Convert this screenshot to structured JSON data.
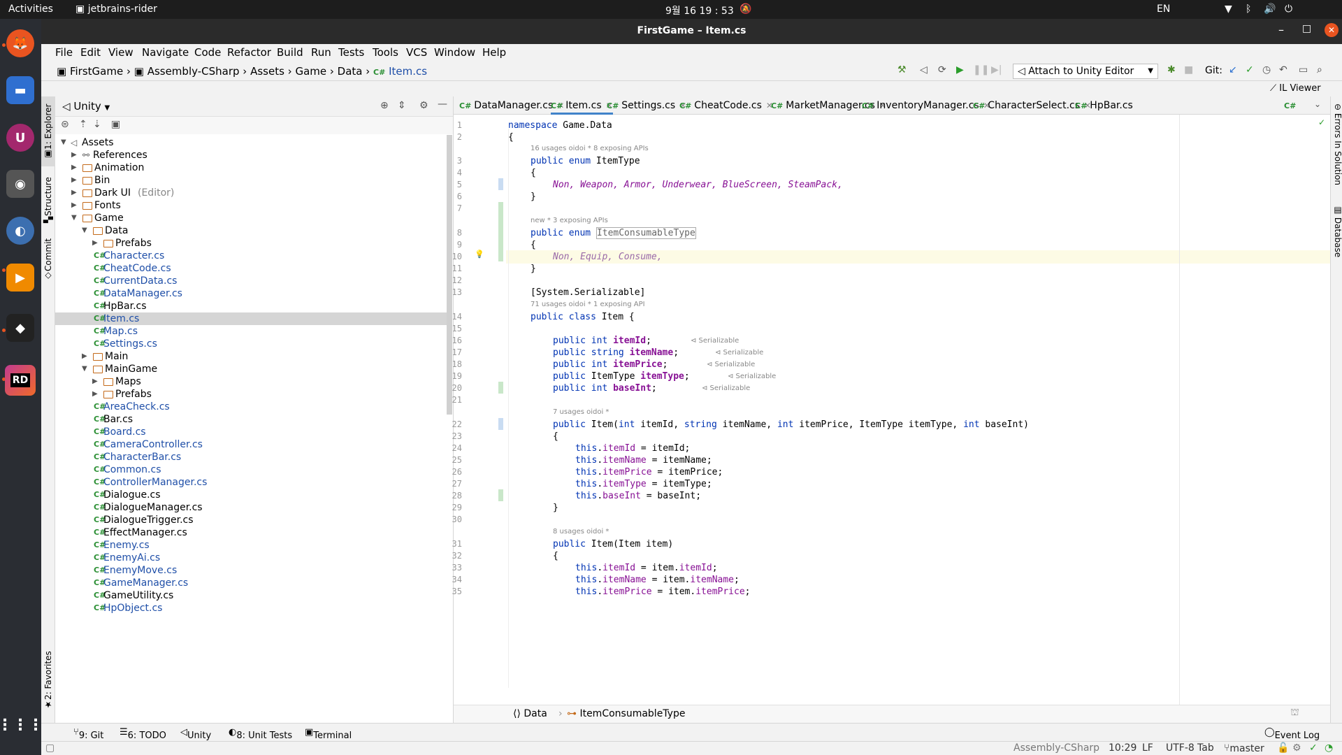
{
  "topbar": {
    "activities": "Activities",
    "app": "jetbrains-rider",
    "clock": "9월 16  19 : 53",
    "lang": "EN"
  },
  "window": {
    "title": "FirstGame – Item.cs"
  },
  "menu": [
    "File",
    "Edit",
    "View",
    "Navigate",
    "Code",
    "Refactor",
    "Build",
    "Run",
    "Tests",
    "Tools",
    "VCS",
    "Window",
    "Help"
  ],
  "nav": {
    "crumbs": [
      "FirstGame",
      "Assembly-CSharp",
      "Assets",
      "Game",
      "Data",
      "Item.cs"
    ],
    "run_config": "Attach to Unity Editor",
    "git": "Git:"
  },
  "il_viewer": "IL Viewer",
  "left_tabs": {
    "explorer": "1: Explorer",
    "structure": "Structure",
    "commit": "Commit",
    "favorites": "2: Favorites"
  },
  "right_tabs": {
    "errors": "Errors In Solution",
    "database": "Database"
  },
  "explorer": {
    "view": "Unity",
    "tree": [
      {
        "label": "Assets",
        "depth": 0,
        "kind": "root",
        "open": true
      },
      {
        "label": "References",
        "depth": 1,
        "kind": "ref",
        "open": false
      },
      {
        "label": "Animation",
        "depth": 1,
        "kind": "folder",
        "open": false
      },
      {
        "label": "Bin",
        "depth": 1,
        "kind": "folder",
        "open": false
      },
      {
        "label": "Dark UI",
        "extra": "(Editor)",
        "depth": 1,
        "kind": "folder",
        "open": false
      },
      {
        "label": "Fonts",
        "depth": 1,
        "kind": "folder",
        "open": false
      },
      {
        "label": "Game",
        "depth": 1,
        "kind": "folder",
        "open": true
      },
      {
        "label": "Data",
        "depth": 2,
        "kind": "folder",
        "open": true
      },
      {
        "label": "Prefabs",
        "depth": 3,
        "kind": "folder",
        "open": false
      },
      {
        "label": "Character.cs",
        "depth": 3,
        "kind": "cs",
        "mod": true
      },
      {
        "label": "CheatCode.cs",
        "depth": 3,
        "kind": "cs",
        "mod": true
      },
      {
        "label": "CurrentData.cs",
        "depth": 3,
        "kind": "cs",
        "mod": true
      },
      {
        "label": "DataManager.cs",
        "depth": 3,
        "kind": "cs",
        "mod": true
      },
      {
        "label": "HpBar.cs",
        "depth": 3,
        "kind": "cs",
        "mod": false
      },
      {
        "label": "Item.cs",
        "depth": 3,
        "kind": "cs",
        "mod": true,
        "selected": true
      },
      {
        "label": "Map.cs",
        "depth": 3,
        "kind": "cs",
        "mod": true
      },
      {
        "label": "Settings.cs",
        "depth": 3,
        "kind": "cs",
        "mod": true
      },
      {
        "label": "Main",
        "depth": 2,
        "kind": "folder",
        "open": false
      },
      {
        "label": "MainGame",
        "depth": 2,
        "kind": "folder",
        "open": true
      },
      {
        "label": "Maps",
        "depth": 3,
        "kind": "folder",
        "open": false
      },
      {
        "label": "Prefabs",
        "depth": 3,
        "kind": "folder",
        "open": false
      },
      {
        "label": "AreaCheck.cs",
        "depth": 3,
        "kind": "cs",
        "mod": true
      },
      {
        "label": "Bar.cs",
        "depth": 3,
        "kind": "cs",
        "mod": false
      },
      {
        "label": "Board.cs",
        "depth": 3,
        "kind": "cs",
        "mod": true
      },
      {
        "label": "CameraController.cs",
        "depth": 3,
        "kind": "cs",
        "mod": true
      },
      {
        "label": "CharacterBar.cs",
        "depth": 3,
        "kind": "cs",
        "mod": true
      },
      {
        "label": "Common.cs",
        "depth": 3,
        "kind": "cs",
        "mod": true
      },
      {
        "label": "ControllerManager.cs",
        "depth": 3,
        "kind": "cs",
        "mod": true
      },
      {
        "label": "Dialogue.cs",
        "depth": 3,
        "kind": "cs",
        "mod": false
      },
      {
        "label": "DialogueManager.cs",
        "depth": 3,
        "kind": "cs",
        "mod": false
      },
      {
        "label": "DialogueTrigger.cs",
        "depth": 3,
        "kind": "cs",
        "mod": false
      },
      {
        "label": "EffectManager.cs",
        "depth": 3,
        "kind": "cs",
        "mod": false
      },
      {
        "label": "Enemy.cs",
        "depth": 3,
        "kind": "cs",
        "mod": true
      },
      {
        "label": "EnemyAi.cs",
        "depth": 3,
        "kind": "cs",
        "mod": true
      },
      {
        "label": "EnemyMove.cs",
        "depth": 3,
        "kind": "cs",
        "mod": true
      },
      {
        "label": "GameManager.cs",
        "depth": 3,
        "kind": "cs",
        "mod": true
      },
      {
        "label": "GameUtility.cs",
        "depth": 3,
        "kind": "cs",
        "mod": false
      },
      {
        "label": "HpObject.cs",
        "depth": 3,
        "kind": "cs",
        "mod": true
      }
    ]
  },
  "tabs": [
    {
      "label": "DataManager.cs",
      "active": false
    },
    {
      "label": "Item.cs",
      "active": true
    },
    {
      "label": "Settings.cs",
      "active": false
    },
    {
      "label": "CheatCode.cs",
      "active": false
    },
    {
      "label": "MarketManager.cs",
      "active": false
    },
    {
      "label": "InventoryManager.cs",
      "active": false
    },
    {
      "label": "CharacterSelect.cs",
      "active": false
    },
    {
      "label": "HpBar.cs",
      "active": false
    }
  ],
  "hints": {
    "h1": [
      "16 usages",
      "oidoi *",
      "8 exposing APIs"
    ],
    "h2": [
      "new *",
      "3 exposing APIs"
    ],
    "h3": [
      "71 usages",
      "oidoi *",
      "1 exposing API"
    ],
    "h4": [
      "7 usages",
      "oidoi *"
    ],
    "h5": [
      "8 usages",
      "oidoi *"
    ],
    "serializable": "Serializable"
  },
  "code": {
    "l1": "namespace Game.Data",
    "l2": "{",
    "l3a": "public enum ",
    "l3b": "ItemType",
    "l4": "{",
    "l5": "Non, Weapon, Armor, Underwear, BlueScreen, SteamPack,",
    "l6": "}",
    "l8a": "public enum ",
    "l8b": "ItemConsumableType",
    "l9": "{",
    "l10": "Non, Equip, Consume,",
    "l11": "}",
    "l13": "[System.Serializable]",
    "l14a": "public class ",
    "l14b": "Item {",
    "l16a": "public int ",
    "l16b": "itemId",
    ";": ";",
    "l17a": "public string ",
    "l17b": "itemName",
    "l18a": "public int ",
    "l18b": "itemPrice",
    "l19a": "public ",
    "l19t": "ItemType ",
    "l19b": "itemType",
    "l20a": "public int ",
    "l20b": "baseInt",
    "l22": "Item(int itemId, string itemName, int itemPrice, ItemType itemType, int baseInt)",
    "l22a": "public ",
    "l23": "{",
    "l24a": "this.",
    "l24b": "itemId",
    " l24c": " = itemId;",
    "l25b": "itemName",
    "l25c": " = itemName;",
    "l26b": "itemPrice",
    "l26c": " = itemPrice;",
    "l27b": "itemType",
    "l27c": " = itemType;",
    "l28b": "baseInt",
    "l28c": " = baseInt;",
    "l29": "}",
    "l31": "Item(Item item)",
    "l32": "{",
    "l33b": "itemId",
    "l33c": " = item.",
    "l33d": "itemId",
    "l34b": "itemName",
    "l34c": " = item.",
    "l34d": "itemName",
    "l35b": "itemPrice",
    "l35c": " = item.",
    "l35d": "itemPrice"
  },
  "line_numbers": [
    "1",
    "2",
    "3",
    "4",
    "5",
    "6",
    "7",
    "8",
    "9",
    "10",
    "11",
    "12",
    "13",
    "14",
    "15",
    "16",
    "17",
    "18",
    "19",
    "20",
    "21",
    "22",
    "23",
    "24",
    "25",
    "26",
    "27",
    "28",
    "29",
    "30",
    "31",
    "32",
    "33",
    "34",
    "35"
  ],
  "editor_breadcrumb": [
    "Data",
    "ItemConsumableType"
  ],
  "bottom_tabs": [
    "9: Git",
    "6: TODO",
    "Unity",
    "8: Unit Tests",
    "Terminal"
  ],
  "event_log": "Event Log",
  "status": {
    "project": "Assembly-CSharp",
    "pos": "10:29",
    "eol": "LF",
    "enc": "UTF-8",
    "indent": "Tab",
    "branch": "master"
  }
}
